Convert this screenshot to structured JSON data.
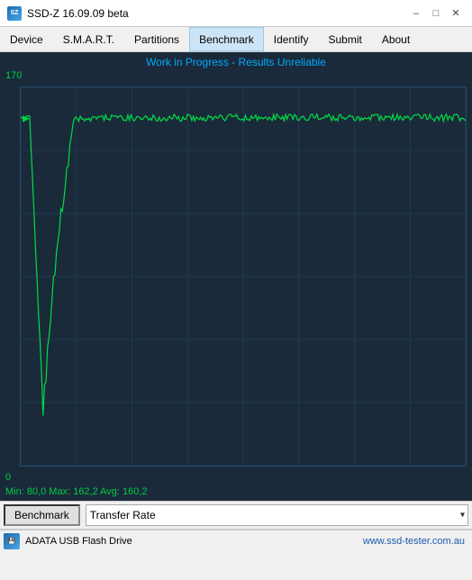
{
  "titleBar": {
    "icon": "SZ",
    "title": "SSD-Z 16.09.09 beta",
    "minimizeLabel": "–",
    "maximizeLabel": "□",
    "closeLabel": "✕"
  },
  "menuBar": {
    "items": [
      {
        "id": "device",
        "label": "Device"
      },
      {
        "id": "smart",
        "label": "S.M.A.R.T."
      },
      {
        "id": "partitions",
        "label": "Partitions"
      },
      {
        "id": "benchmark",
        "label": "Benchmark",
        "active": true
      },
      {
        "id": "identify",
        "label": "Identify"
      },
      {
        "id": "submit",
        "label": "Submit"
      },
      {
        "id": "about",
        "label": "About"
      }
    ]
  },
  "chart": {
    "title": "Work in Progress - Results Unreliable",
    "yLabelTop": "170",
    "yLabelBottom": "0",
    "stats": "Min: 80,0  Max: 162,2  Avg: 160,2",
    "gridLines": {
      "horizontal": 6,
      "vertical": 8
    }
  },
  "toolbar": {
    "benchmarkLabel": "Benchmark",
    "selectOptions": [
      {
        "value": "transfer",
        "label": "Transfer Rate"
      }
    ],
    "selectValue": "Transfer Rate",
    "arrowIcon": "▾"
  },
  "statusBar": {
    "driveLabel": "ADATA USB Flash Drive",
    "url": "www.ssd-tester.com.au"
  }
}
